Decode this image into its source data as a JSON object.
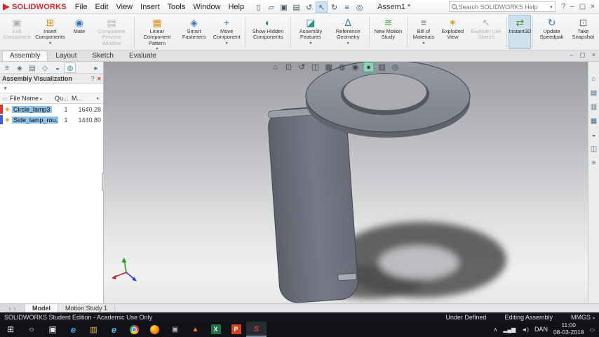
{
  "colors": {
    "brand_red": "#d1252b",
    "selection_blue": "#8ec0ea",
    "instant3d_active_bg": "#cde0ec",
    "hud_active_green": "#8ed1b4",
    "viewport_gradient_top": "#9b9da3",
    "viewport_gradient_bottom": "#e7e7e9",
    "statusbar_bg": "#14161a",
    "taskbar_bg": "#111217"
  },
  "titlebar": {
    "logo_text": "SOLIDWORKS",
    "menus": [
      "File",
      "Edit",
      "View",
      "Insert",
      "Tools",
      "Window",
      "Help"
    ],
    "doc_title": "Assem1 *",
    "search_placeholder": "Search SOLIDWORKS Help",
    "search_caret": "▾",
    "quick_icons": [
      {
        "name": "new-document-icon",
        "glyph": "▯"
      },
      {
        "name": "open-icon",
        "glyph": "▱"
      },
      {
        "name": "save-icon",
        "glyph": "▣"
      },
      {
        "name": "print-icon",
        "glyph": "▤"
      },
      {
        "name": "undo-icon",
        "glyph": "↺"
      },
      {
        "name": "select-pointer-icon",
        "glyph": "↖"
      },
      {
        "name": "rebuild-icon",
        "glyph": "↻"
      },
      {
        "name": "file-properties-icon",
        "glyph": "≡"
      },
      {
        "name": "options-icon",
        "glyph": "◎"
      }
    ],
    "window": {
      "help": "?",
      "minimize": "–",
      "restore": "▢",
      "close": "×"
    }
  },
  "ribbon": {
    "caret": "▾",
    "tabs": [
      "Assembly",
      "Layout",
      "Sketch",
      "Evaluate"
    ],
    "buttons": [
      {
        "label": "Edit Component",
        "glyph": "▣",
        "enabled": false
      },
      {
        "label": "Insert Components",
        "glyph": "⊞",
        "enabled": true
      },
      {
        "label": "Mate",
        "glyph": "◉",
        "enabled": true
      },
      {
        "label": "Component Preview Window",
        "glyph": "▤",
        "enabled": false
      },
      {
        "label": "Linear Component Pattern",
        "glyph": "▦",
        "enabled": true
      },
      {
        "label": "Smart Fasteners",
        "glyph": "◈",
        "enabled": true
      },
      {
        "label": "Move Component",
        "glyph": "+",
        "enabled": true
      },
      {
        "label": "Show Hidden Components",
        "glyph": "◐",
        "enabled": true
      },
      {
        "label": "Assembly Features",
        "glyph": "◪",
        "enabled": true
      },
      {
        "label": "Reference Geometry",
        "glyph": "∆",
        "enabled": true
      },
      {
        "label": "New Motion Study",
        "glyph": "≋",
        "enabled": true
      },
      {
        "label": "Bill of Materials",
        "glyph": "≡",
        "enabled": true
      },
      {
        "label": "Exploded View",
        "glyph": "✶",
        "enabled": true
      },
      {
        "label": "Explode Line Sketch",
        "glyph": "↖",
        "enabled": false
      },
      {
        "label": "Instant3D",
        "glyph": "⇄",
        "enabled": true,
        "active": true
      },
      {
        "label": "Update Speedpak",
        "glyph": "↻",
        "enabled": true
      },
      {
        "label": "Take Snapshot",
        "glyph": "⊡",
        "enabled": true
      }
    ]
  },
  "panel": {
    "title": "Assembly Visualization",
    "help_glyph": "?",
    "close_glyph": "×",
    "filter_glyph": "▼",
    "flat_view_glyph": "▭",
    "sort_glyph": "▴",
    "expand_glyph": "▸",
    "overflow_glyph": "▸",
    "feature_tabs": [
      {
        "name": "featuremanager-tree-tab",
        "glyph": "≡"
      },
      {
        "name": "propertymanager-tab",
        "glyph": "◈"
      },
      {
        "name": "configurationmanager-tab",
        "glyph": "▤"
      },
      {
        "name": "dimxpert-tab",
        "glyph": "◇"
      },
      {
        "name": "displaymanager-tab",
        "glyph": "◒"
      },
      {
        "name": "visualization-tab",
        "glyph": "◍",
        "active": true
      }
    ],
    "columns": {
      "file": "File Name",
      "qty": "Qu...",
      "mass": "M..."
    },
    "part_icon_glyph": "◈",
    "rows": [
      {
        "name": "Circle_lamp3",
        "qty": "1",
        "mass": "1640.28"
      },
      {
        "name": "Side_lamp_rou...",
        "qty": "1",
        "mass": "1440.80"
      }
    ]
  },
  "viewport": {
    "hud_icons": [
      {
        "name": "zoom-fit-icon",
        "glyph": "⌂"
      },
      {
        "name": "zoom-area-icon",
        "glyph": "⊡"
      },
      {
        "name": "previous-view-icon",
        "glyph": "↺"
      },
      {
        "name": "section-view-icon",
        "glyph": "◫"
      },
      {
        "name": "view-orientation-icon",
        "glyph": "▦"
      },
      {
        "name": "display-style-icon",
        "glyph": "◍"
      },
      {
        "name": "hide-show-items-icon",
        "glyph": "◉"
      },
      {
        "name": "edit-appearance-icon",
        "glyph": "●",
        "active": true
      },
      {
        "name": "apply-scene-icon",
        "glyph": "▨"
      },
      {
        "name": "view-settings-icon",
        "glyph": "◎"
      }
    ],
    "window_icons": {
      "minimize": "–",
      "restore": "▢",
      "close": "×"
    }
  },
  "taskpane": {
    "icons": [
      {
        "name": "resources-icon",
        "glyph": "⌂"
      },
      {
        "name": "design-library-icon",
        "glyph": "▤"
      },
      {
        "name": "file-explorer-icon",
        "glyph": "▥"
      },
      {
        "name": "view-palette-icon",
        "glyph": "▦"
      },
      {
        "name": "appearances-icon",
        "glyph": "◒"
      },
      {
        "name": "scenes-icon",
        "glyph": "◫"
      },
      {
        "name": "custom-properties-icon",
        "glyph": "≡"
      }
    ]
  },
  "bottom_tabs": {
    "nav_left": "‹",
    "nav_right": "›",
    "tabs": [
      "Model",
      "Motion Study 1"
    ]
  },
  "statusbar": {
    "edition": "SOLIDWORKS Student Edition - Academic Use Only",
    "state": "Under Defined",
    "mode": "Editing Assembly",
    "units": "MMGS",
    "units_caret": "▾"
  },
  "taskbar": {
    "start_glyph": "⊞",
    "search_glyph": "○",
    "taskview_glyph": "▣",
    "apps": [
      {
        "name": "edge",
        "glyph": "e"
      },
      {
        "name": "file-explorer",
        "glyph": "▥"
      },
      {
        "name": "internet-explorer",
        "glyph": "e"
      },
      {
        "name": "chrome",
        "glyph": ""
      },
      {
        "name": "firefox",
        "glyph": ""
      },
      {
        "name": "settings",
        "glyph": "▣"
      },
      {
        "name": "vlc",
        "glyph": "▲"
      },
      {
        "name": "excel",
        "glyph": "X"
      },
      {
        "name": "powerpoint",
        "glyph": "P"
      },
      {
        "name": "solidworks",
        "glyph": "S",
        "active": true
      }
    ],
    "tray": {
      "chevron": "∧",
      "network_glyph": "▂▄▆",
      "volume_glyph": "◄)",
      "language": "DAN",
      "time": "11:00",
      "date": "08-03-2018",
      "notification_glyph": "▭"
    }
  }
}
